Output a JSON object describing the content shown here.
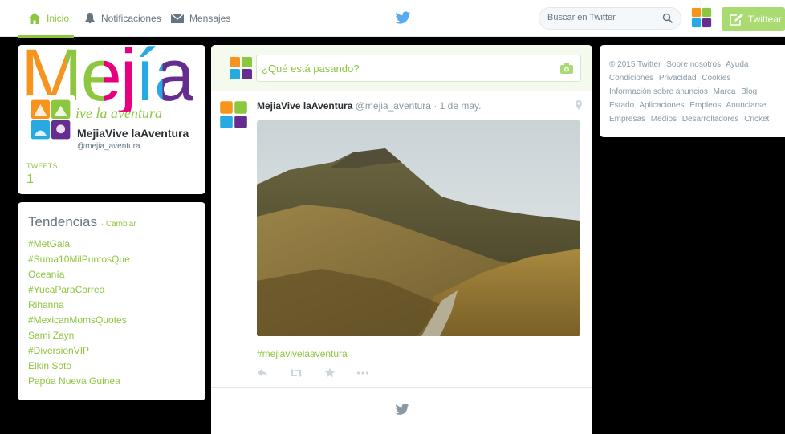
{
  "nav": {
    "home": "Inicio",
    "notifications": "Notificaciones",
    "messages": "Mensajes",
    "search_placeholder": "Buscar en Twitter",
    "tweet_button": "Twittear"
  },
  "profile": {
    "banner_word": "Mejía",
    "banner_sub": "vive la aventura",
    "name": "MejiaVive laAventura",
    "handle": "@mejia_aventura",
    "tweets_label": "TWEETS",
    "tweets_count": "1"
  },
  "trends": {
    "title": "Tendencias",
    "change": "· Cambiar",
    "items": [
      "#MetGala",
      "#Suma10MilPuntosQue",
      "Oceanía",
      "#YucaParaCorrea",
      "Rihanna",
      "#MexicanMomsQuotes",
      "Sami Zayn",
      "#DiversionVIP",
      "Elkin Soto",
      "Papúa Nueva Guinea"
    ]
  },
  "composer": {
    "placeholder": "¿Qué está pasando?"
  },
  "tweet": {
    "name": "MejiaVive laAventura",
    "handle": "@mejia_aventura",
    "date": "· 1 de may.",
    "hashtag": "#mejiavivelaaventura"
  },
  "footer": {
    "links": [
      "© 2015 Twitter",
      "Sobre nosotros",
      "Ayuda",
      "Condiciones",
      "Privacidad",
      "Cookies",
      "Información sobre anuncios",
      "Marca",
      "Blog",
      "Estado",
      "Aplicaciones",
      "Empleos",
      "Anunciarse",
      "Empresas",
      "Medios",
      "Desarrolladores",
      "Cricket"
    ]
  },
  "colors": {
    "accent": "#8dc63f",
    "tweet_button": "#a9db72",
    "background": "#000000"
  }
}
